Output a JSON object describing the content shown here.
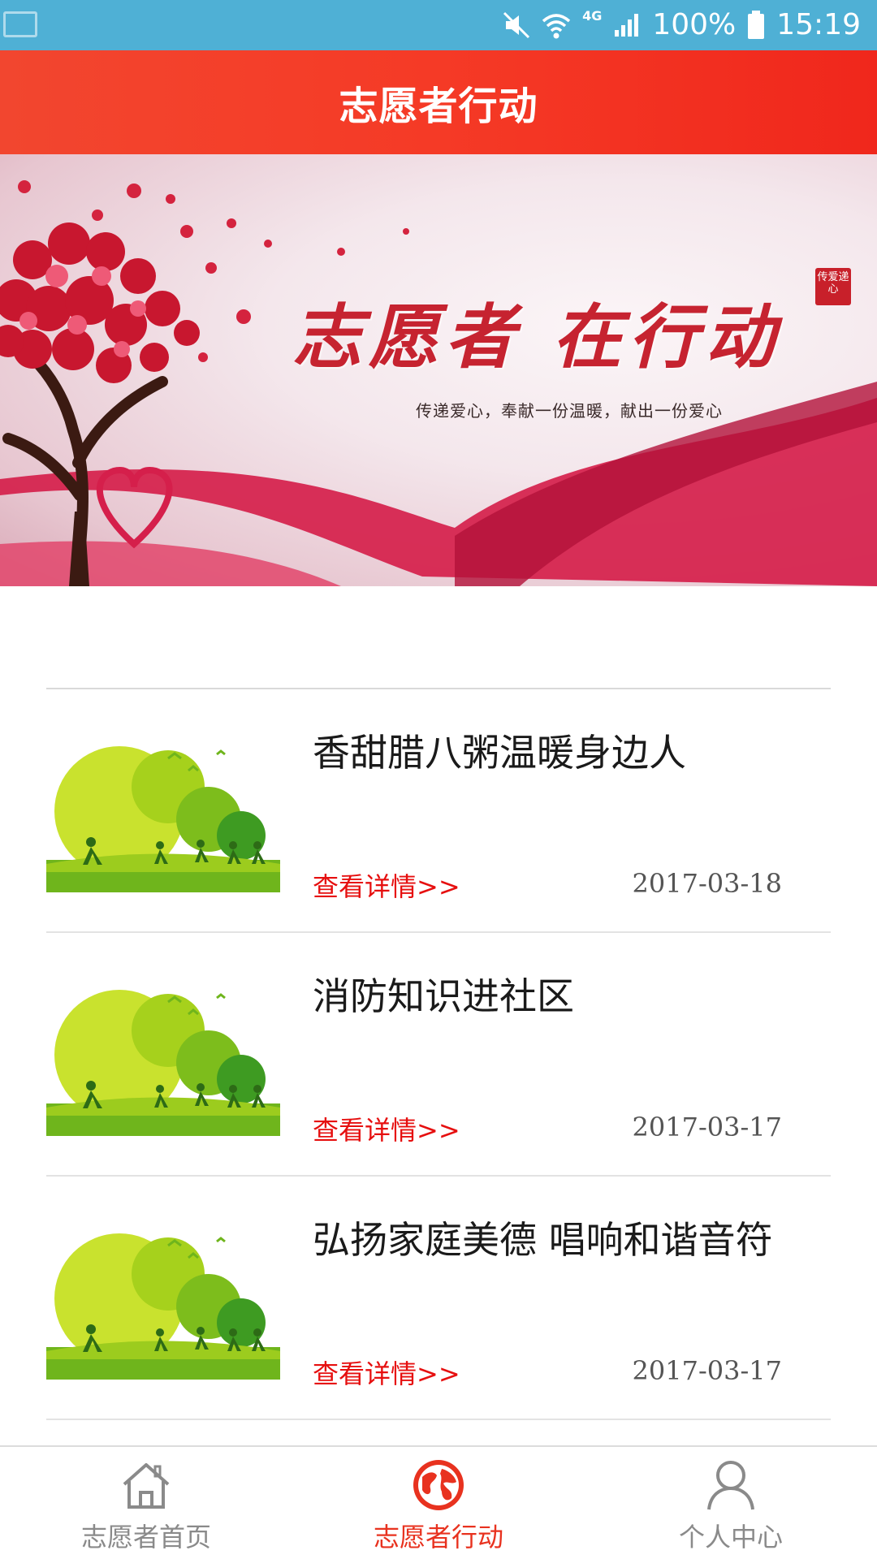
{
  "status_bar": {
    "battery": "100%",
    "time": "15:19",
    "network": "4G",
    "icons": [
      "screenshot-icon",
      "mute-icon",
      "wifi-icon",
      "signal-icon",
      "battery-icon"
    ]
  },
  "header": {
    "title": "志愿者行动"
  },
  "banner": {
    "title": "志愿者 在行动",
    "subtitle": "传递爱心，奉献一份温暖，献出一份爱心",
    "seal": "传爱递心"
  },
  "news": [
    {
      "title": "香甜腊八粥温暖身边人",
      "link": "查看详情>>",
      "date": "2017-03-18"
    },
    {
      "title": "消防知识进社区",
      "link": "查看详情>>",
      "date": "2017-03-17"
    },
    {
      "title": "弘扬家庭美德 唱响和谐音符",
      "link": "查看详情>>",
      "date": "2017-03-17"
    }
  ],
  "bottom_nav": {
    "items": [
      {
        "label": "志愿者首页",
        "icon": "home-icon"
      },
      {
        "label": "志愿者行动",
        "icon": "globe-icon",
        "active": true
      },
      {
        "label": "个人中心",
        "icon": "person-icon"
      }
    ]
  },
  "colors": {
    "status_bar": "#4fb0d5",
    "header": "#f53a26",
    "accent_red": "#e60f0f",
    "nav_active": "#e8321f",
    "nav_inactive": "#8a8a8a"
  }
}
